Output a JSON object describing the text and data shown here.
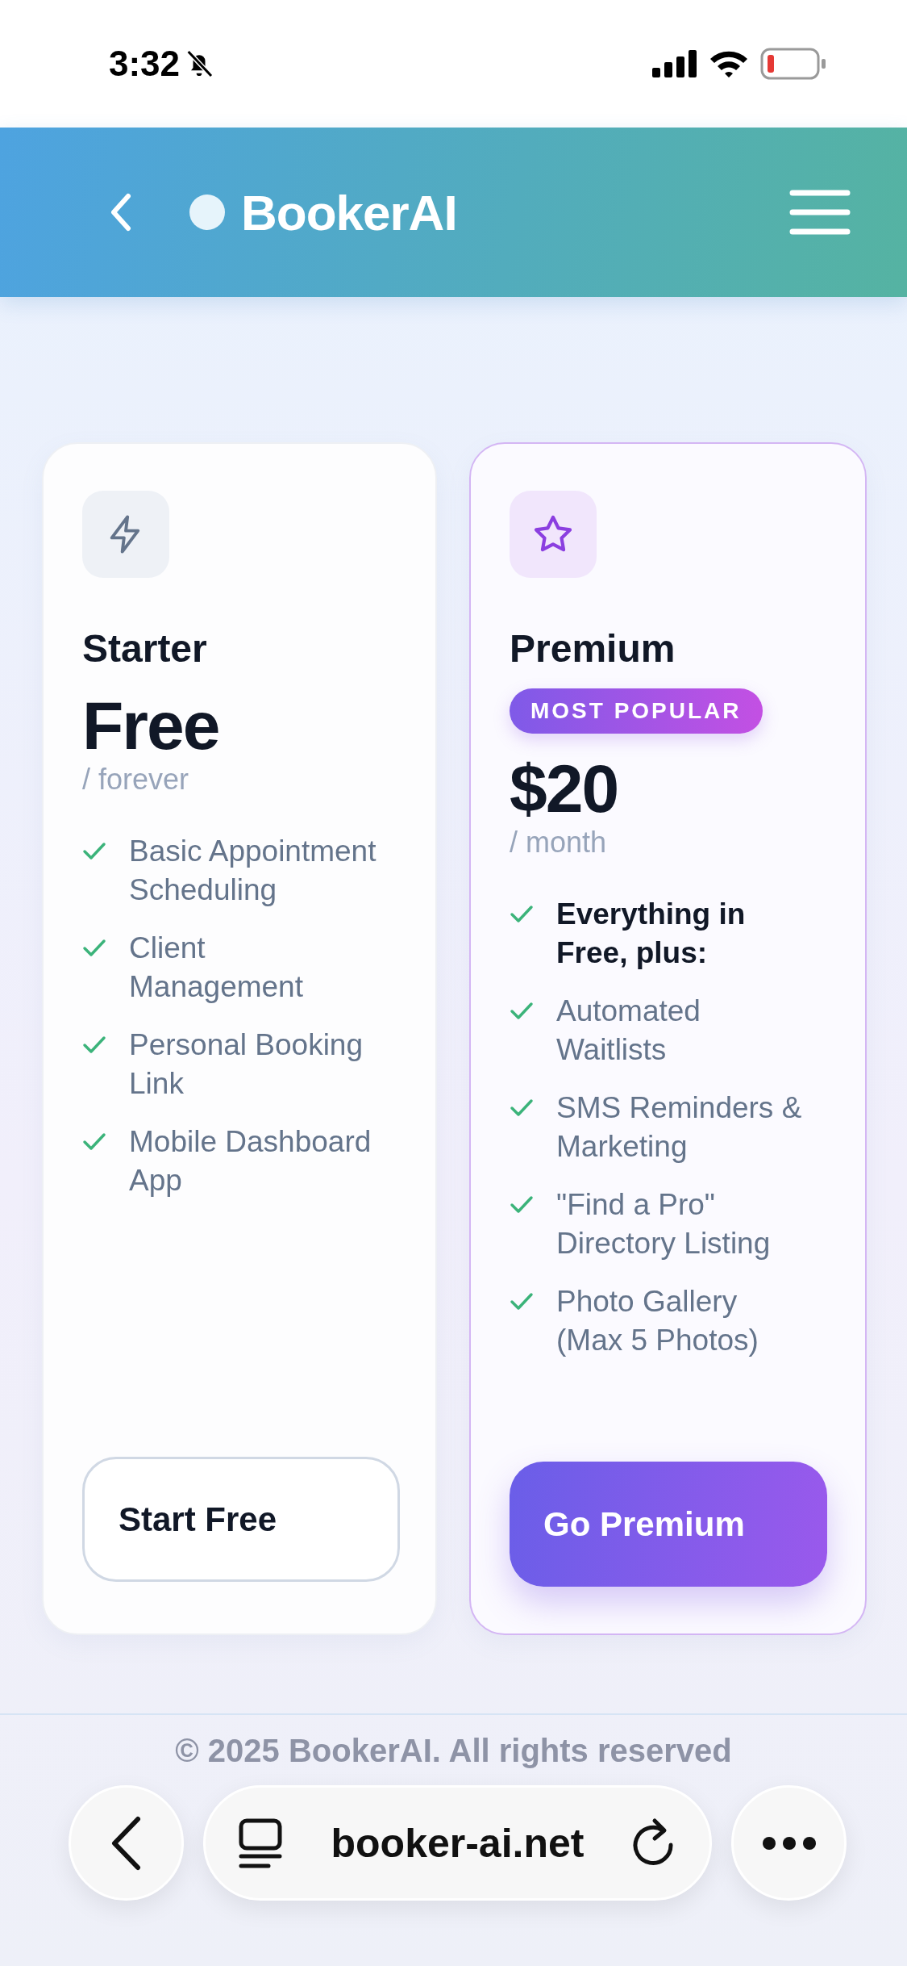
{
  "status_bar": {
    "time": "3:32"
  },
  "header": {
    "brand": "BookerAI"
  },
  "plans": [
    {
      "name": "Starter",
      "featured": false,
      "price": "Free",
      "period": "/ forever",
      "features": [
        {
          "kind": "feature",
          "text": "Basic Appointment Scheduling"
        },
        {
          "kind": "feature",
          "text": "Client Management"
        },
        {
          "kind": "feature",
          "text": "Personal Booking Link"
        },
        {
          "kind": "feature",
          "text": "Mobile Dashboard App"
        }
      ],
      "button": "Start Free"
    },
    {
      "name": "Premium",
      "featured": true,
      "badge": "MOST POPULAR",
      "price": "$20",
      "period": "/ month",
      "features": [
        {
          "kind": "lead",
          "text": "Everything in Free, plus:"
        },
        {
          "kind": "feature",
          "text": "Automated Waitlists"
        },
        {
          "kind": "feature",
          "text": "SMS Reminders & Marketing"
        },
        {
          "kind": "feature",
          "text": "\"Find a Pro\" Directory Listing"
        },
        {
          "kind": "feature",
          "text": "Photo Gallery (Max 5 Photos)"
        }
      ],
      "button": "Go Premium"
    }
  ],
  "footer": {
    "text": "© 2025 BookerAI. All rights reserved"
  },
  "browser_bar": {
    "url": "booker-ai.net"
  }
}
